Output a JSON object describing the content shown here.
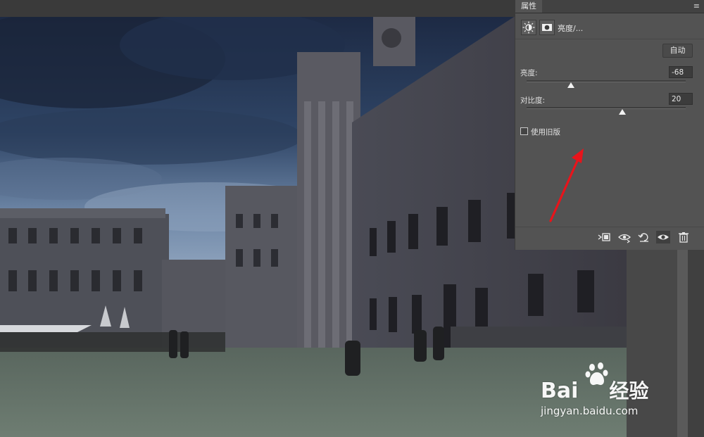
{
  "panel": {
    "tab_title": "属性",
    "menu_icon": "hamburger-menu-icon",
    "adjustment_type_label": "亮度/...",
    "auto_button_label": "自动",
    "brightness": {
      "label": "亮度:",
      "value": "-68",
      "slider_fraction": 0.28
    },
    "contrast": {
      "label": "对比度:",
      "value": "20",
      "slider_fraction": 0.6
    },
    "legacy": {
      "label": "使用旧版",
      "checked": false
    },
    "footer_icons": [
      "clip-to-layer-icon",
      "view-previous-state-icon",
      "reset-icon",
      "visibility-eye-icon",
      "delete-trash-icon"
    ]
  },
  "watermark": {
    "brand": "Bai",
    "brand_suffix": "经验",
    "url": "jingyan.baidu.com"
  },
  "annotation": {
    "arrow_color": "#e8141b"
  }
}
